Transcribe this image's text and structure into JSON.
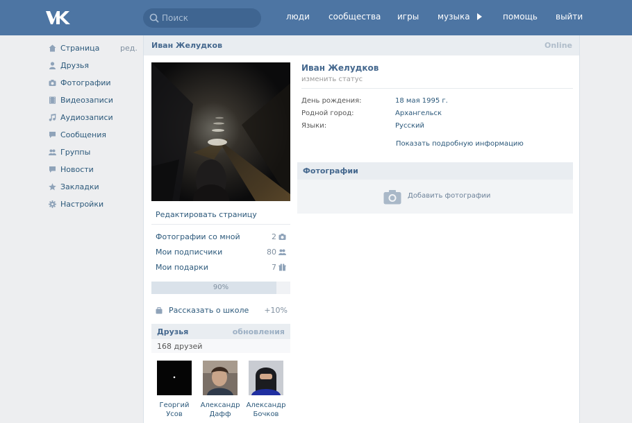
{
  "header": {
    "search_placeholder": "Поиск",
    "nav": [
      "люди",
      "сообщества",
      "игры",
      "музыка",
      "помощь",
      "выйти"
    ]
  },
  "sidebar": {
    "edit_label": "ред.",
    "items": [
      {
        "label": "Страница",
        "icon": "home-icon"
      },
      {
        "label": "Друзья",
        "icon": "person-icon"
      },
      {
        "label": "Фотографии",
        "icon": "camera-icon"
      },
      {
        "label": "Видеозаписи",
        "icon": "film-icon"
      },
      {
        "label": "Аудиозаписи",
        "icon": "music-note-icon"
      },
      {
        "label": "Сообщения",
        "icon": "chat-bubble-icon"
      },
      {
        "label": "Группы",
        "icon": "group-icon"
      },
      {
        "label": "Новости",
        "icon": "news-bubble-icon"
      },
      {
        "label": "Закладки",
        "icon": "star-icon"
      },
      {
        "label": "Настройки",
        "icon": "gear-icon"
      }
    ]
  },
  "page": {
    "title": "Иван Желудков",
    "online": "Online"
  },
  "left_column": {
    "edit_page": "Редактировать страницу",
    "stats": [
      {
        "label": "Фотографии со мной",
        "count": "2",
        "icon": "camera-icon"
      },
      {
        "label": "Мои подписчики",
        "count": "80",
        "icon": "people-icon"
      },
      {
        "label": "Мои подарки",
        "count": "7",
        "icon": "gift-icon"
      }
    ],
    "progress_text": "90%",
    "progress_value": 0.9,
    "school": {
      "label": "Рассказать о школе",
      "bonus": "+10%"
    },
    "friends": {
      "title": "Друзья",
      "updates": "обновления",
      "count": "168 друзей",
      "list": [
        {
          "first": "Георгий",
          "last": "Усов"
        },
        {
          "first": "Александр",
          "last": "Дафф"
        },
        {
          "first": "Александр",
          "last": "Бочков"
        }
      ]
    }
  },
  "profile": {
    "name": "Иван Желудков",
    "status": "изменить статус",
    "info": [
      {
        "label": "День рождения:",
        "value": "18 мая 1995 г."
      },
      {
        "label": "Родной город:",
        "value": "Архангельск"
      },
      {
        "label": "Языки:",
        "value": "Русский"
      }
    ],
    "more_info": "Показать подробную информацию",
    "photos_title": "Фотографии",
    "add_photos": "Добавить фотографии"
  },
  "colors": {
    "header_bg": "#4d75a3",
    "link": "#2b587a",
    "title": "#45688e",
    "page_bg": "#edeef0"
  }
}
